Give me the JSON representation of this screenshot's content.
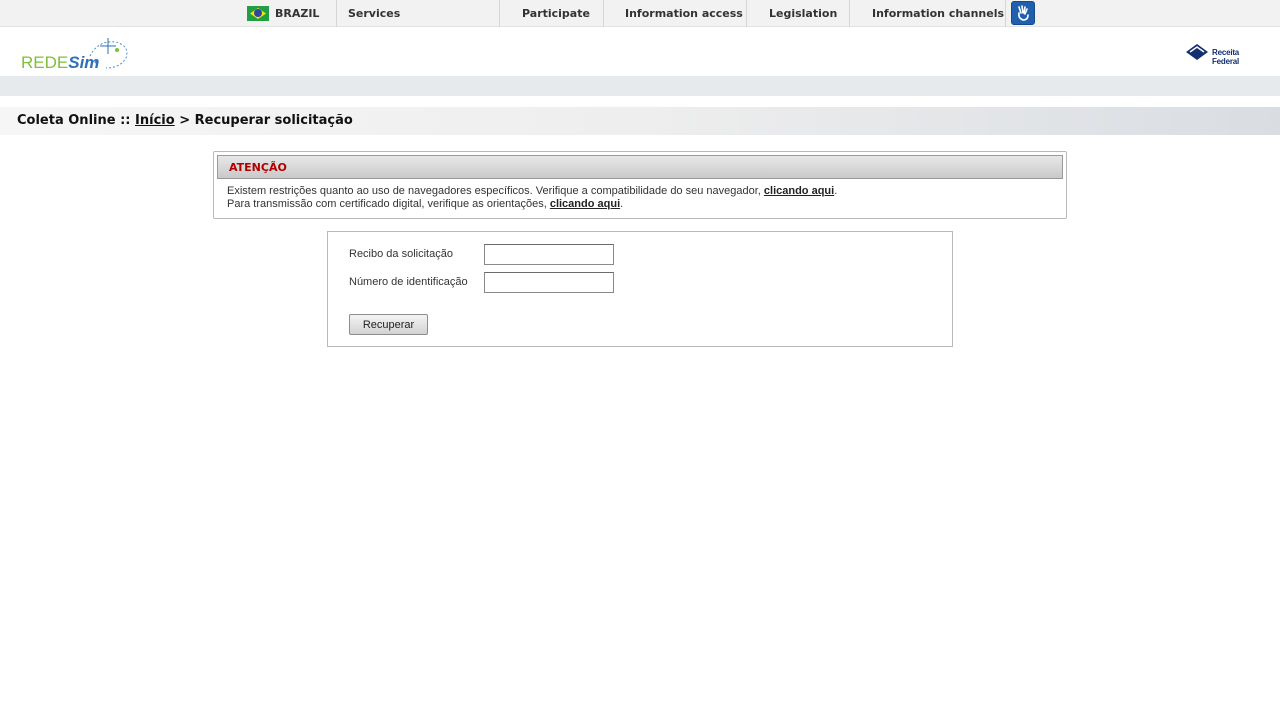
{
  "govbar": {
    "country": "BRAZIL",
    "links": [
      "Services",
      "Participate",
      "Information access",
      "Legislation",
      "Information channels"
    ]
  },
  "header": {
    "logo_left_a": "REDE",
    "logo_left_b": "Sim",
    "logo_right": "Receita Federal"
  },
  "breadcrumb": {
    "prefix": "Coleta Online ::",
    "home": "Início",
    "separator": ">",
    "current": "Recuperar solicitação"
  },
  "attention": {
    "title": "ATENÇÃO",
    "line1_text": "Existem restrições quanto ao uso de navegadores específicos. Verifique a compatibilidade do seu navegador, ",
    "line1_link": "clicando aqui",
    "line2_text": "Para transmissão com certificado digital, verifique as orientações, ",
    "line2_link": "clicando aqui",
    "period": "."
  },
  "form": {
    "receipt_label": "Recibo da solicitação",
    "receipt_value": "",
    "id_label": "Número de identificação",
    "id_value": "",
    "submit_label": "Recuperar"
  },
  "colors": {
    "alert_title": "#b10000",
    "logo_green": "#7fbf3a",
    "logo_blue": "#2f6fb5",
    "receita_blue": "#12306e"
  }
}
